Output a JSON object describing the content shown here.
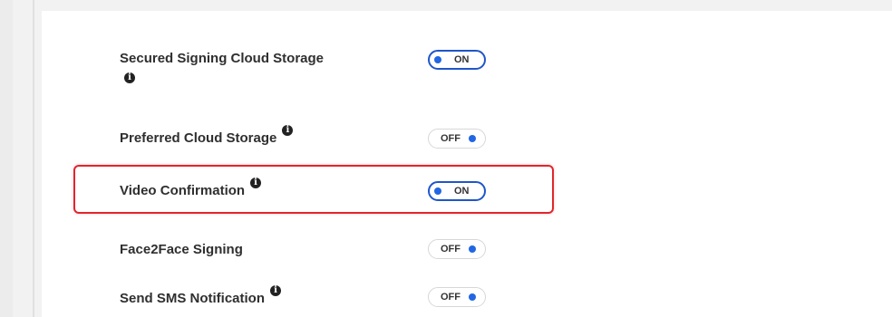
{
  "settings": [
    {
      "label": "Secured Signing Cloud Storage",
      "state": "ON",
      "info_icon": "info-icon"
    },
    {
      "label": "Preferred Cloud Storage",
      "state": "OFF",
      "info_icon": "info-icon"
    },
    {
      "label": "Video Confirmation",
      "state": "ON",
      "info_icon": "info-icon",
      "highlighted": true
    },
    {
      "label": "Face2Face Signing",
      "state": "OFF"
    },
    {
      "label": "Send SMS Notification",
      "state": "OFF",
      "info_icon": "info-icon"
    }
  ],
  "colors": {
    "toggle_accent": "#1f56c9",
    "knob": "#2166e3",
    "highlight": "#e0262d"
  }
}
